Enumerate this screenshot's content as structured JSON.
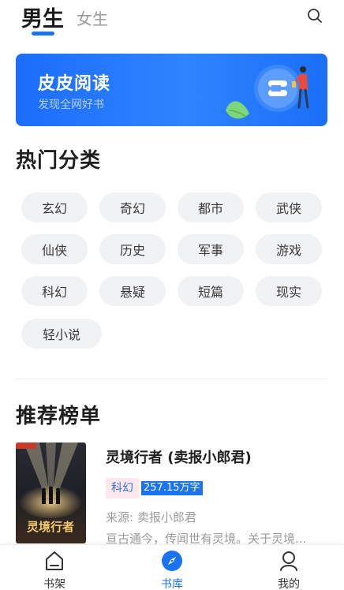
{
  "top_tabs": {
    "male": "男生",
    "female": "女生"
  },
  "banner": {
    "title": "皮皮阅读",
    "subtitle": "发现全网好书"
  },
  "hot_categories": {
    "title": "热门分类",
    "items": [
      "玄幻",
      "奇幻",
      "都市",
      "武侠",
      "仙侠",
      "历史",
      "军事",
      "游戏",
      "科幻",
      "悬疑",
      "短篇",
      "现实",
      "轻小说"
    ]
  },
  "ranking": {
    "title": "推荐榜单",
    "book": {
      "title": "灵境行者 (卖报小郎君)",
      "genre_tag": "科幻",
      "word_count": "257.15万字",
      "source": "来源: 卖报小郎君",
      "description": "亘古通今，传闻世有灵境。关于灵境...",
      "cover_title": "灵境行者"
    }
  },
  "bottom_nav": {
    "shelf": "书架",
    "library": "书库",
    "mine": "我的"
  },
  "colors": {
    "accent": "#1a73f0",
    "chip_bg": "#f1f2f4",
    "tag_pink": "#fde8ee"
  },
  "icons": {
    "search": "search-icon",
    "shelf": "house-icon",
    "library": "compass-icon",
    "mine": "person-icon"
  }
}
